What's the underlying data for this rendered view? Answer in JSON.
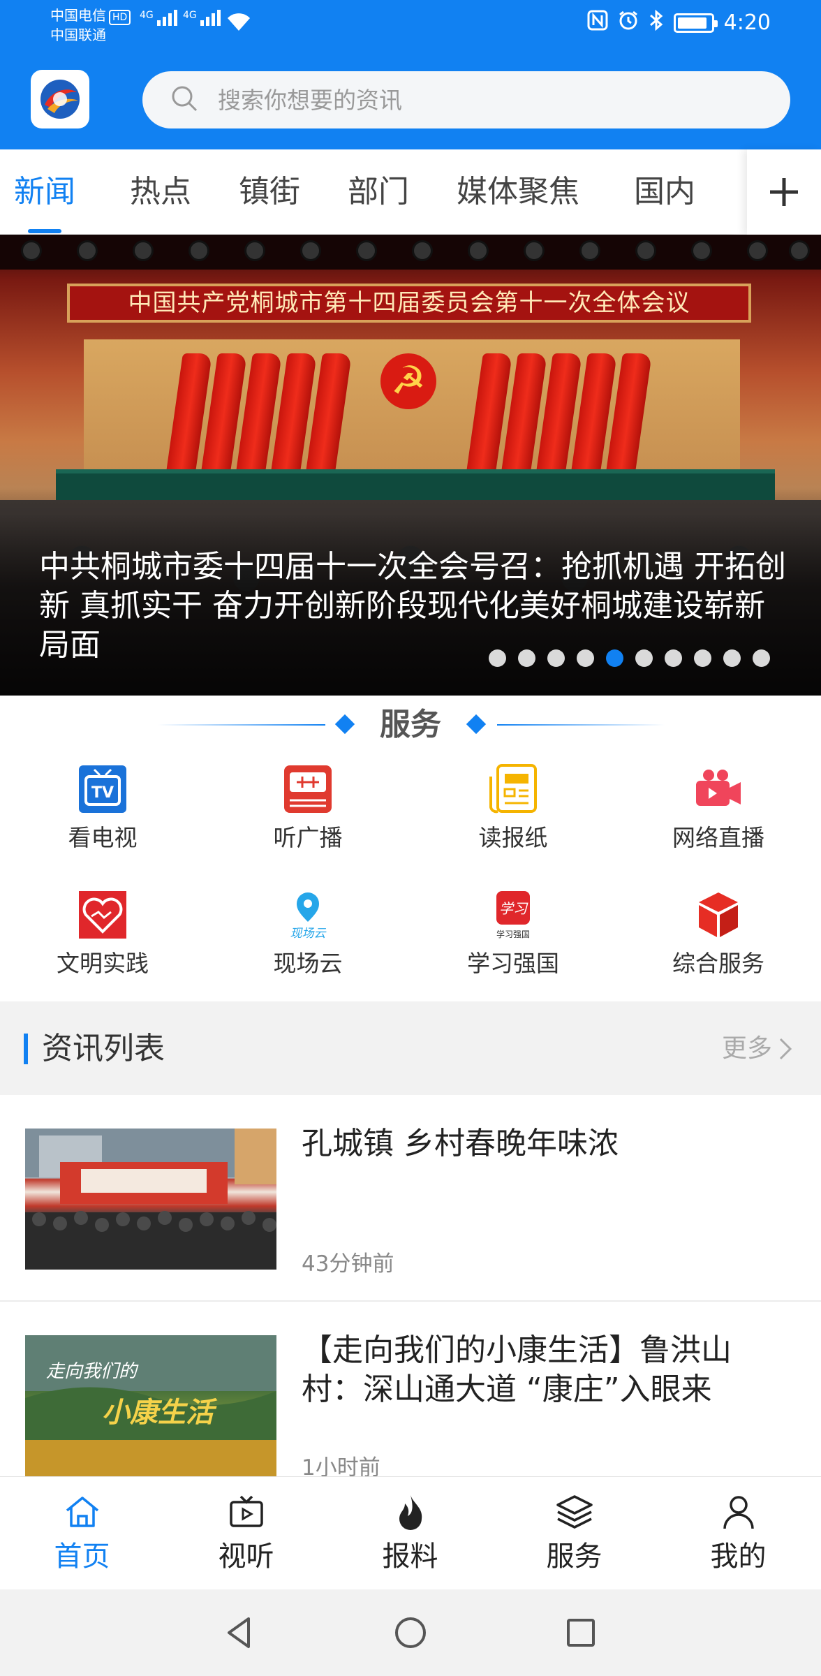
{
  "status_bar": {
    "carrier1": "中国电信",
    "carrier1_badge": "HD",
    "carrier2": "中国联通",
    "signal1_label": "4G",
    "signal2_label": "4G",
    "time": "4:20",
    "icons": [
      "nfc-icon",
      "alarm-icon",
      "bluetooth-icon",
      "battery-icon"
    ],
    "battery_level": 0.9
  },
  "header": {
    "logo": "app-logo",
    "search_placeholder": "搜索你想要的资讯"
  },
  "tabs": {
    "items": [
      {
        "label": "新闻",
        "active": true
      },
      {
        "label": "热点",
        "active": false
      },
      {
        "label": "镇街",
        "active": false
      },
      {
        "label": "部门",
        "active": false
      },
      {
        "label": "媒体聚焦",
        "active": false
      },
      {
        "label": "国内",
        "active": false
      }
    ],
    "add_icon": "plus-icon"
  },
  "banner": {
    "sign_text": "中国共产党桐城市第十四届委员会第十一次全体会议",
    "caption": "中共桐城市委十四届十一次全会号召：抢抓机遇 开拓创新 真抓实干 奋力开创新阶段现代化美好桐城建设崭新局面",
    "dots_total": 10,
    "dot_active_index": 4
  },
  "services": {
    "title": "服务",
    "items": [
      {
        "label": "看电视",
        "icon": "tv-icon"
      },
      {
        "label": "听广播",
        "icon": "radio-icon"
      },
      {
        "label": "读报纸",
        "icon": "newspaper-icon"
      },
      {
        "label": "网络直播",
        "icon": "live-camera-icon"
      },
      {
        "label": "文明实践",
        "icon": "heart-hands-icon"
      },
      {
        "label": "现场云",
        "icon": "location-cloud-icon"
      },
      {
        "label": "学习强国",
        "icon": "xuexi-qiangguo-icon"
      },
      {
        "label": "综合服务",
        "icon": "cube-icon"
      }
    ]
  },
  "news_list": {
    "title": "资讯列表",
    "more_label": "更多",
    "items": [
      {
        "title": "孔城镇  乡村春晚年味浓",
        "time": "43分钟前"
      },
      {
        "title": "【走向我们的小康生活】鲁洪山村：深山通大道 “康庄”入眼来",
        "time": "1小时前"
      }
    ]
  },
  "bottom_nav": {
    "items": [
      {
        "label": "首页",
        "icon": "home-icon",
        "active": true
      },
      {
        "label": "视听",
        "icon": "video-icon",
        "active": false
      },
      {
        "label": "报料",
        "icon": "flame-icon",
        "active": false
      },
      {
        "label": "服务",
        "icon": "layers-icon",
        "active": false
      },
      {
        "label": "我的",
        "icon": "user-icon",
        "active": false
      }
    ]
  },
  "colors": {
    "brand_blue": "#1181f2",
    "text_dark": "#222222",
    "text_muted": "#888888"
  }
}
